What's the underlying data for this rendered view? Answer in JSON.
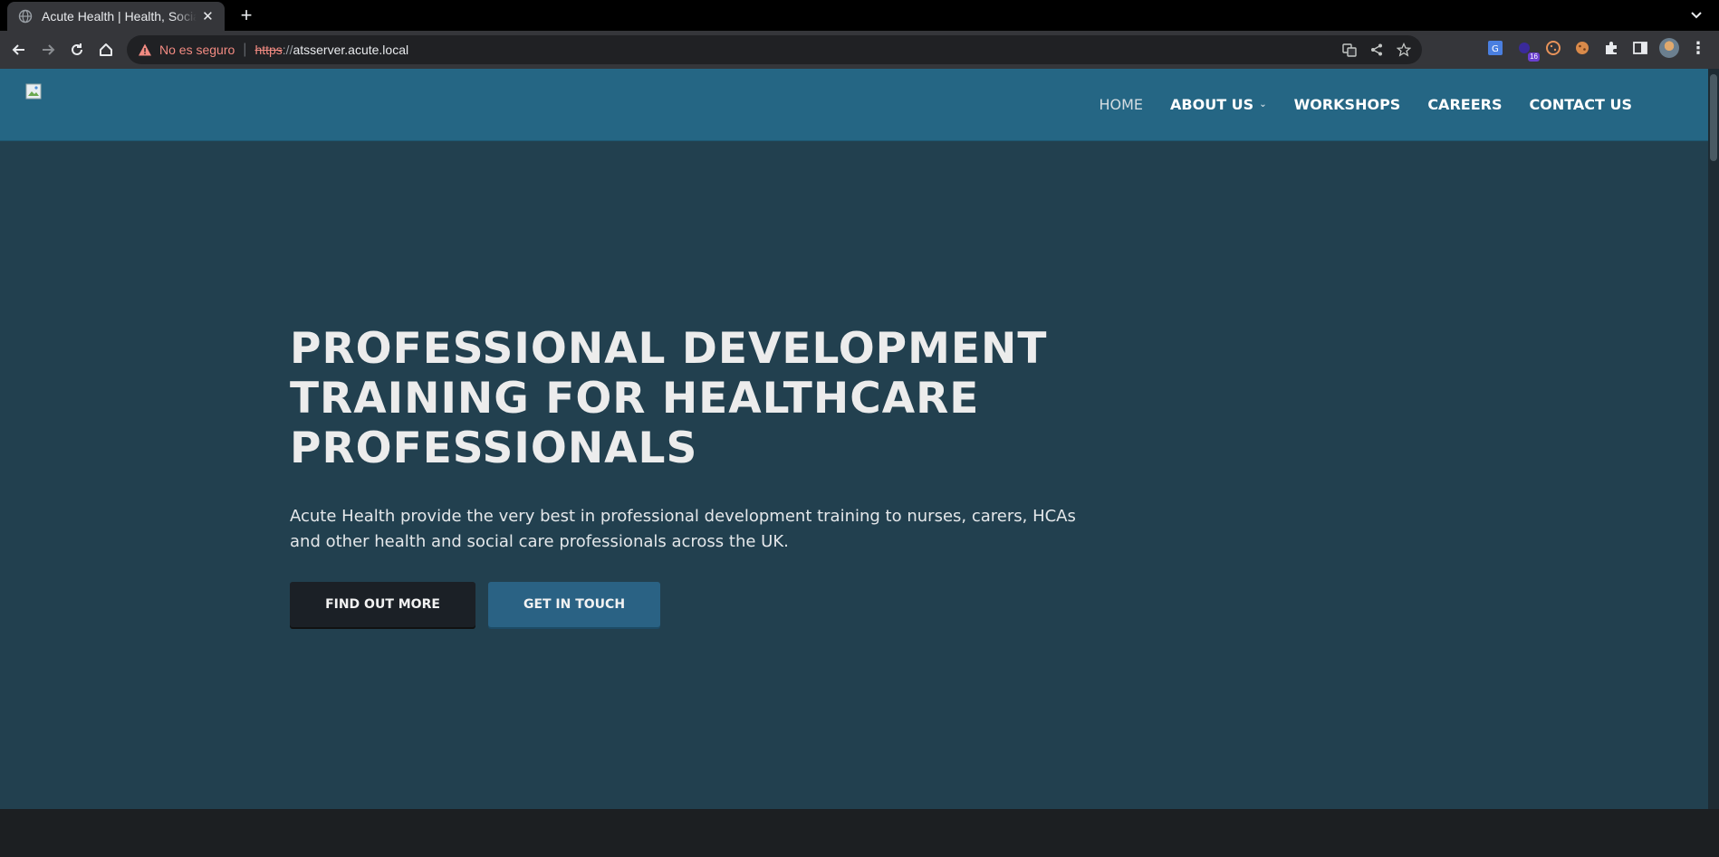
{
  "browser": {
    "tab": {
      "title": "Acute Health | Health, Social"
    },
    "address_bar": {
      "security_label": "No es seguro",
      "scheme": "https",
      "scheme_separator": "://",
      "host": "atsserver.acute.local"
    },
    "extensions": {
      "badge_count": "16"
    }
  },
  "site": {
    "nav": {
      "items": [
        {
          "label": "HOME",
          "active": true
        },
        {
          "label": "ABOUT US",
          "has_dropdown": true
        },
        {
          "label": "WORKSHOPS"
        },
        {
          "label": "CAREERS"
        },
        {
          "label": "CONTACT US"
        }
      ]
    },
    "hero": {
      "title": "PROFESSIONAL DEVELOPMENT TRAINING FOR HEALTHCARE PROFESSIONALS",
      "description": "Acute Health provide the very best in professional development training to nurses, carers, HCAs and other health and social care professionals across the UK.",
      "primary_button": "FIND OUT MORE",
      "secondary_button": "GET IN TOUCH"
    }
  },
  "colors": {
    "header_bg": "#256684",
    "hero_bg": "#22404f",
    "dark_button": "#1b2026",
    "blue_button": "#2a6284",
    "footer_bg": "#1c1f22"
  }
}
